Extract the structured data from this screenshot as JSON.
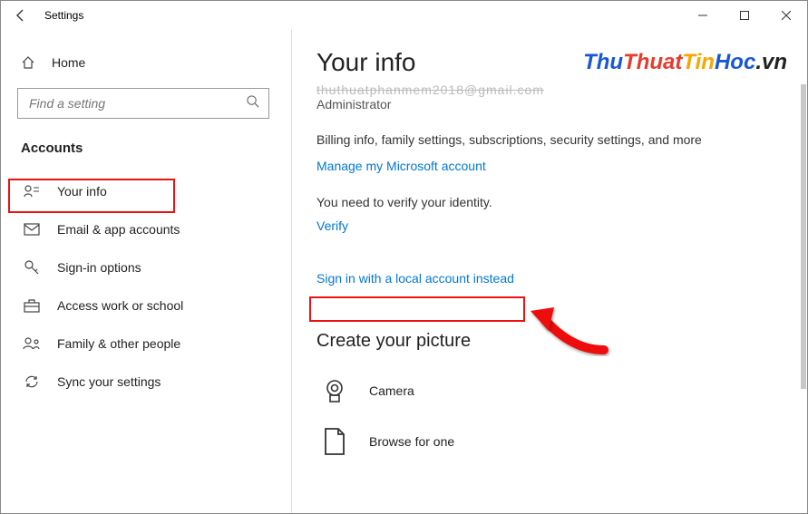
{
  "window": {
    "title": "Settings"
  },
  "sidebar": {
    "home_label": "Home",
    "search_placeholder": "Find a setting",
    "group_header": "Accounts",
    "items": [
      {
        "label": "Your info"
      },
      {
        "label": "Email & app accounts"
      },
      {
        "label": "Sign-in options"
      },
      {
        "label": "Access work or school"
      },
      {
        "label": "Family & other people"
      },
      {
        "label": "Sync your settings"
      }
    ]
  },
  "content": {
    "title": "Your info",
    "email_obscured": "thuthuatphanmem2018@gmail.com",
    "role": "Administrator",
    "billing_text": "Billing info, family settings, subscriptions, security settings, and more",
    "manage_link": "Manage my Microsoft account",
    "verify_text": "You need to verify your identity.",
    "verify_link": "Verify",
    "local_account_link": "Sign in with a local account instead",
    "picture_header": "Create your picture",
    "camera_label": "Camera",
    "browse_label": "Browse for one"
  },
  "watermark": {
    "part1": "Thu",
    "part2": "Thuat",
    "part3": "Tin",
    "part4": "Hoc",
    "dot": ".",
    "ext": "vn"
  }
}
